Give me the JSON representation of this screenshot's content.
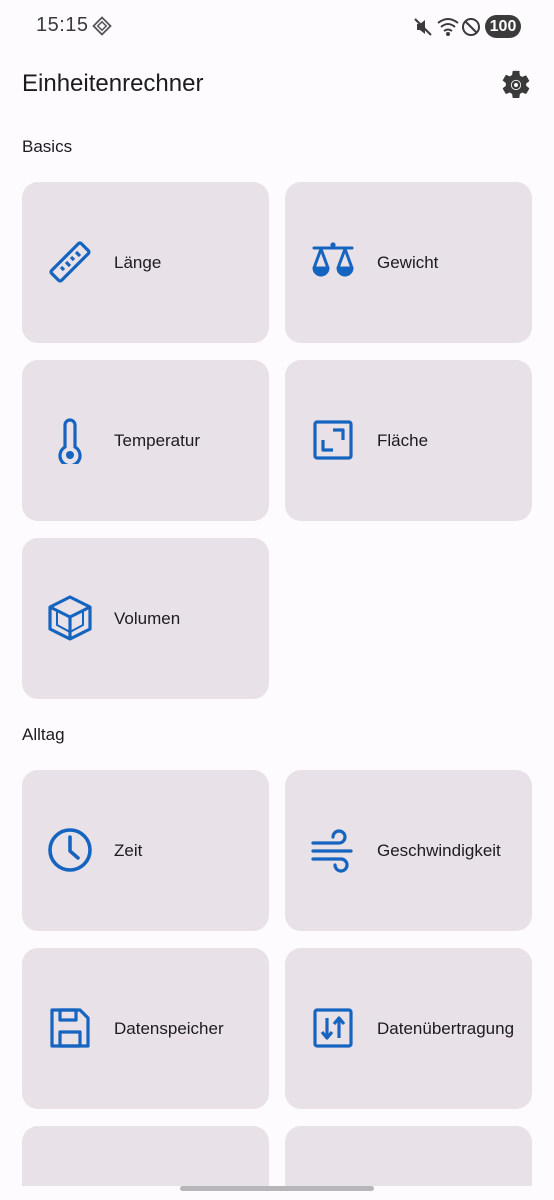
{
  "status": {
    "time": "15:15",
    "battery": "100",
    "icons": [
      "app-notification-icon",
      "mute-icon",
      "wifi-icon",
      "do-not-disturb-icon"
    ]
  },
  "app": {
    "title": "Einheitenrechner",
    "settings_icon": "gear-icon"
  },
  "sections": {
    "basics": {
      "title": "Basics",
      "items": [
        {
          "label": "Länge",
          "icon": "ruler-icon"
        },
        {
          "label": "Gewicht",
          "icon": "scale-icon"
        },
        {
          "label": "Temperatur",
          "icon": "thermometer-icon"
        },
        {
          "label": "Fläche",
          "icon": "area-icon"
        },
        {
          "label": "Volumen",
          "icon": "cube-icon"
        }
      ]
    },
    "alltag": {
      "title": "Alltag",
      "items": [
        {
          "label": "Zeit",
          "icon": "clock-icon"
        },
        {
          "label": "Geschwindigkeit",
          "icon": "wind-icon"
        },
        {
          "label": "Datenspeicher",
          "icon": "floppy-disk-icon"
        },
        {
          "label": "Datenübertragung",
          "icon": "transfer-arrows-icon"
        }
      ]
    }
  },
  "colors": {
    "accent": "#1565c0",
    "tile": "#e8e1e8",
    "background": "#fdfbfe"
  }
}
